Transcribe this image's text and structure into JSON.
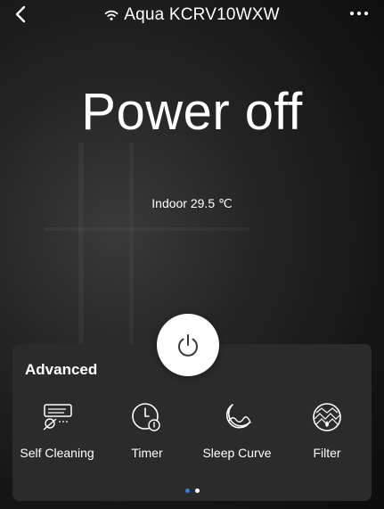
{
  "header": {
    "title": "Aqua KCRV10WXW",
    "back_icon": "chevron-left-icon",
    "wifi_icon": "wifi-icon",
    "more_icon": "more-dots-icon"
  },
  "status": {
    "power_text": "Power off",
    "indoor_text": "Indoor 29.5 ℃"
  },
  "power_button": {
    "icon": "power-icon"
  },
  "advanced": {
    "title": "Advanced",
    "items": [
      {
        "label": "Self Cleaning",
        "icon": "self-cleaning-icon"
      },
      {
        "label": "Timer",
        "icon": "timer-icon"
      },
      {
        "label": "Sleep Curve",
        "icon": "sleep-curve-icon"
      },
      {
        "label": "Filter",
        "icon": "filter-icon"
      }
    ],
    "page_count": 2,
    "current_page": 1
  },
  "colors": {
    "panel_bg": "#2b2b2b",
    "dot_active": "#2f7fe8",
    "dot_inactive": "#ffffff",
    "power_icon": "#3a3a3a"
  }
}
